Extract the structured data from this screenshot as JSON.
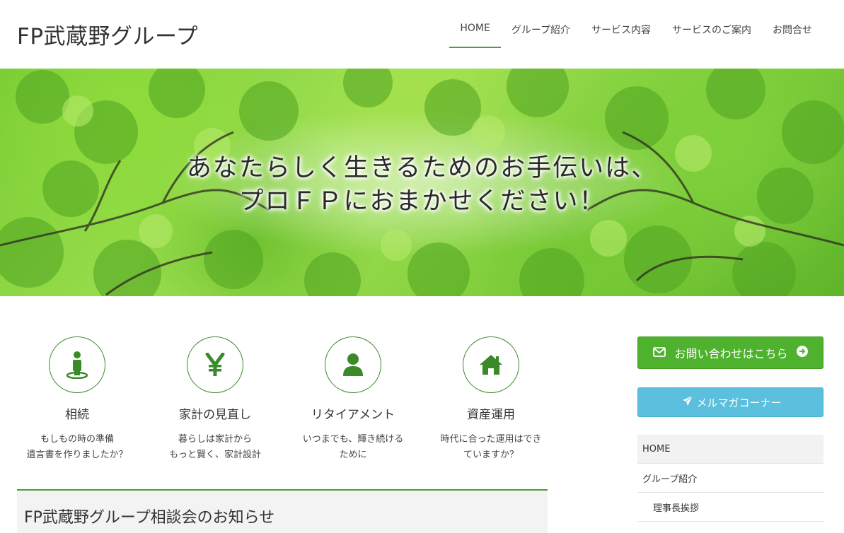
{
  "header": {
    "site_title": "FP武蔵野グループ",
    "nav": [
      {
        "label": "HOME"
      },
      {
        "label": "グループ紹介"
      },
      {
        "label": "サービス内容"
      },
      {
        "label": "サービスのご案内"
      },
      {
        "label": "お問合せ"
      }
    ]
  },
  "hero": {
    "line1": "あなたらしく生きるためのお手伝いは、",
    "line2": "プロＦＰにおまかせください！"
  },
  "features": [
    {
      "title": "相続",
      "desc1": "もしもの時の準備",
      "desc2": "遺言書を作りましたか？",
      "icon": "person-pin-icon"
    },
    {
      "title": "家計の見直し",
      "desc1": "暮らしは家計から",
      "desc2": "もっと賢く、家計設計",
      "icon": "yen-icon"
    },
    {
      "title": "リタイアメント",
      "desc1": "いつまでも、輝き続ける",
      "desc2": "ために",
      "icon": "user-icon"
    },
    {
      "title": "資産運用",
      "desc1": "時代に合った運用はでき",
      "desc2": "ていますか？",
      "icon": "home-icon"
    }
  ],
  "notice": {
    "title": "FP武蔵野グループ相談会のお知らせ"
  },
  "sidebar": {
    "contact_label": "お問い合わせはこちら",
    "mail_label": "メルマガコーナー",
    "menu": [
      {
        "label": "HOME"
      },
      {
        "label": "グループ紹介"
      },
      {
        "label": "理事長挨拶"
      }
    ]
  },
  "colors": {
    "accent": "#4aa135",
    "contact_btn": "#4eb22e",
    "mail_btn": "#5bc0de",
    "icon_green": "#3b8a2a"
  }
}
